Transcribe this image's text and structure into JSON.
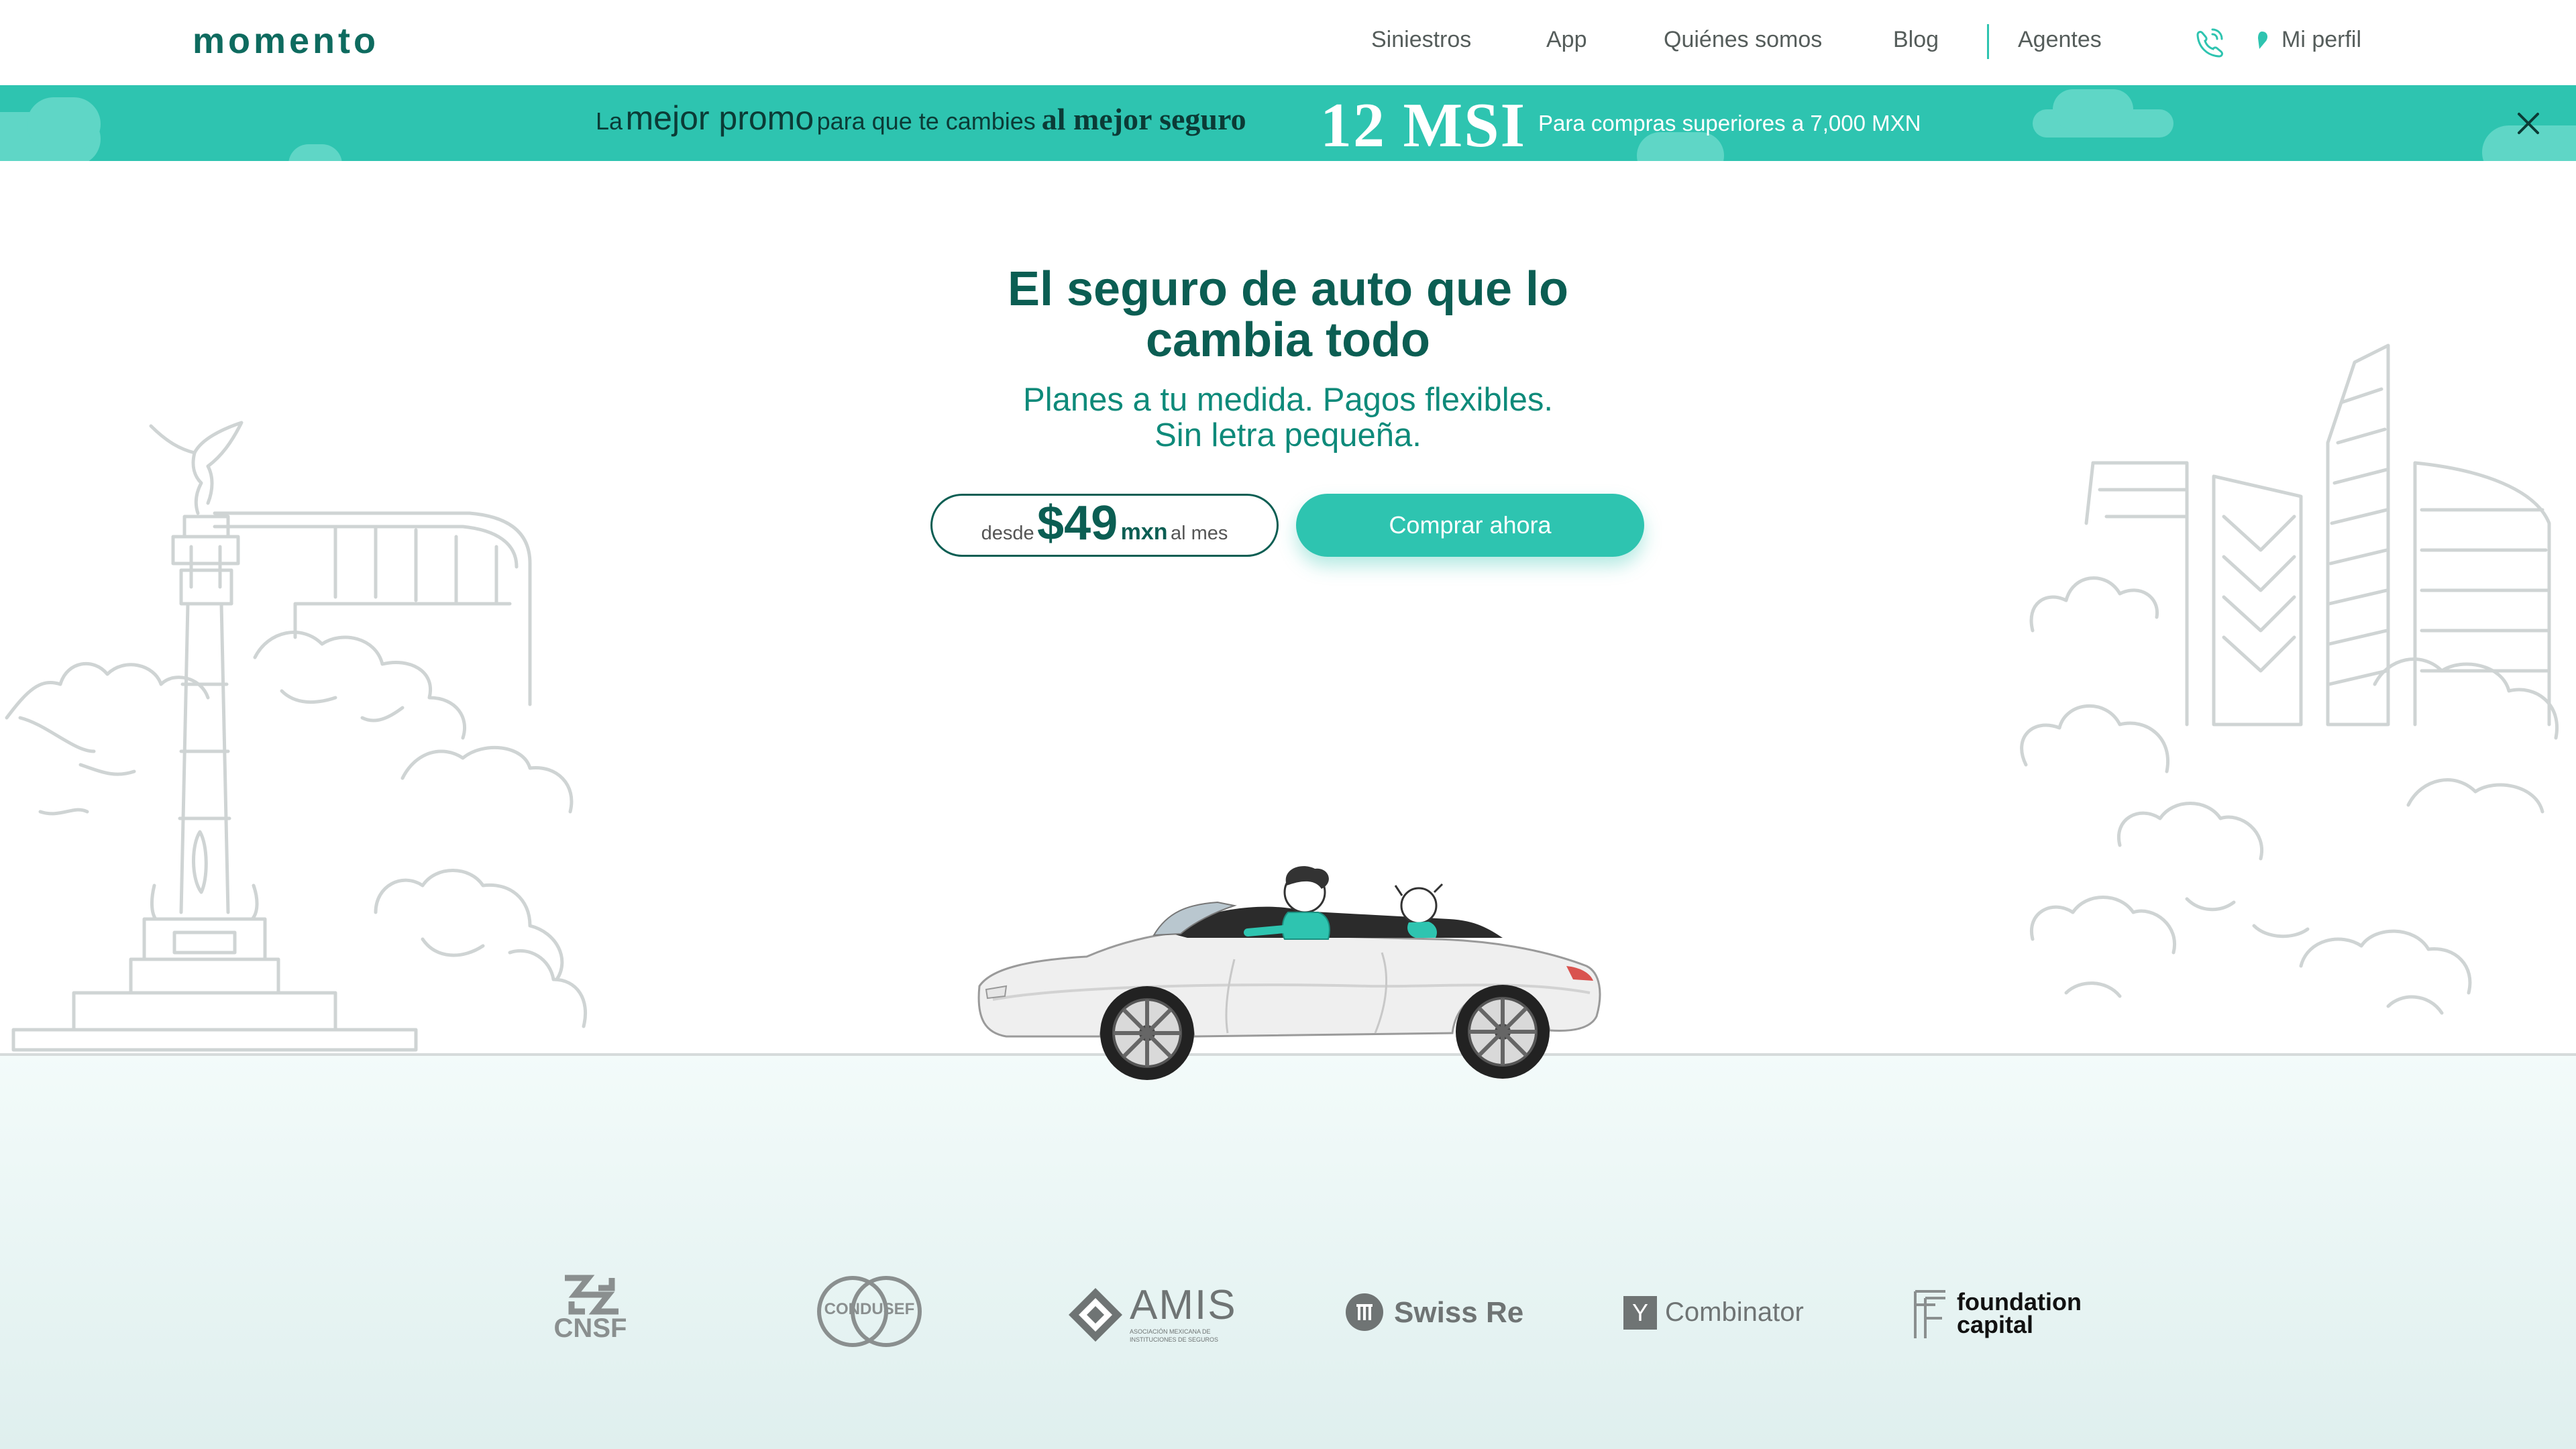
{
  "nav": {
    "logo": "momento",
    "links": [
      "Siniestros",
      "App",
      "Quiénes somos",
      "Blog",
      "Agentes"
    ],
    "profile": "Mi perfil"
  },
  "promo": {
    "part1": "La",
    "part2": "mejor promo",
    "part3": "para que te cambies",
    "part4": "al mejor seguro",
    "badge": "12 MSI",
    "note": "Para compras superiores a 7,000 MXN"
  },
  "hero": {
    "title_line1": "El seguro de auto que lo",
    "title_line2": "cambia todo",
    "subtitle_line1": "Planes a tu medida. Pagos flexibles.",
    "subtitle_line2": "Sin letra pequeña.",
    "price_prefix": "desde",
    "price": "$49",
    "price_currency": "mxn",
    "price_suffix": "al mes",
    "cta": "Comprar ahora"
  },
  "partners": {
    "cnsf": "CNSF",
    "condusef": "CONDUSEF",
    "amis": "AMIS",
    "amis_sub1": "ASOCIACIÓN MEXICANA DE",
    "amis_sub2": "INSTITUCIONES DE SEGUROS",
    "swissre": "Swiss Re",
    "yc_letter": "Y",
    "yc": "Combinator",
    "fc_line1": "foundation",
    "fc_line2": "capital"
  },
  "colors": {
    "brand": "#0b5e53",
    "accent": "#2ec4b0",
    "promo_bg": "#2ec4b0"
  }
}
